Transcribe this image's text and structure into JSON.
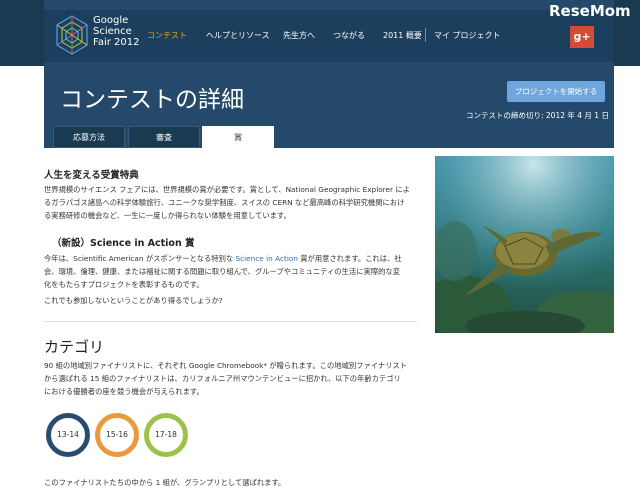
{
  "nav": {
    "logo_line1": "Google",
    "logo_line2": "Science",
    "logo_line3": "Fair 2012",
    "items": [
      "コンテスト",
      "ヘルプとリソース",
      "先生方へ",
      "つながる",
      "2011 概要",
      "マイ プロジェクト"
    ],
    "gplus_label": "g+",
    "watermark": "ReseMom"
  },
  "header": {
    "title": "コンテストの詳細",
    "start_button": "プロジェクトを開始する",
    "deadline": "コンテストの締め切り: 2012 年 4 月 1 日"
  },
  "tabs": [
    "応募方法",
    "審査",
    "賞"
  ],
  "section1": {
    "heading": "人生を変える受賞特典",
    "lines": [
      "世界規模のサイエンス フェアには、世界規模の賞が必要です。賞として、National Geographic Explorer によ",
      "るガラパゴス諸島への科学体験旅行、ユニークな奨学制度、スイスの CERN など最高峰の科学研究機関におけ",
      "る実務研修の機会など、一生に一度しか得られない体験を用意しています。"
    ]
  },
  "section2": {
    "heading": "（新設）Science in Action 賞",
    "line1_pre": "今年は、Scientific American がスポンサーとなる特別な ",
    "line1_link": "Science in Action",
    "line1_post": " 賞が用意されます。これは、社",
    "line2": "会、環境、倫理、健康、または福祉に関する問題に取り組んで、グループやコミュニティの生活に実際的な変",
    "line3": "化をもたらすプロジェクトを表彰するものです。",
    "line4": "これでも参加しないということがあり得るでしょうか?"
  },
  "category": {
    "heading": "カテゴリ",
    "lines": [
      "90 組の地域別ファイナリストに、それぞれ Google Chromebook* が贈られます。この地域別ファイナリスト",
      "から選ばれる 15 組のファイナリストは、カリフォルニア州マウンテンビューに招かれ、以下の年齢カテゴリ",
      "における優勝者の座を競う機会が与えられます。"
    ],
    "age_groups": [
      {
        "label": "13-14",
        "color": "#2a4d6e"
      },
      {
        "label": "15-16",
        "color": "#e89a3c"
      },
      {
        "label": "17-18",
        "color": "#9cc24a"
      }
    ],
    "footer": "このファイナリストたちの中から 1 組が、グランプリとして選ばれます。"
  },
  "colors": {
    "header_bg": "#24496a",
    "accent_orange": "#f0a020",
    "button_blue": "#6fa6dd",
    "gplus_red": "#d84a38"
  }
}
